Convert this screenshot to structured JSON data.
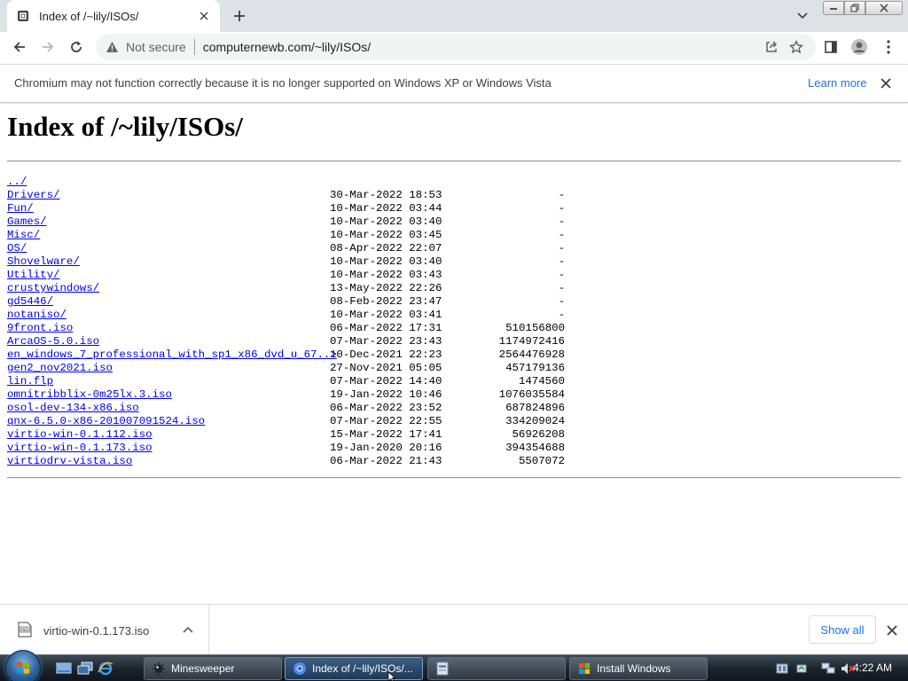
{
  "browser": {
    "tab_title": "Index of /~lily/ISOs/",
    "omnibox": {
      "security_label": "Not secure",
      "url": "computernewb.com/~lily/ISOs/"
    }
  },
  "infobar": {
    "message": "Chromium may not function correctly because it is no longer supported on Windows XP or Windows Vista",
    "link": "Learn more"
  },
  "page": {
    "title": "Index of /~lily/ISOs/",
    "entries": [
      {
        "name": "../",
        "date": "",
        "size": ""
      },
      {
        "name": "Drivers/",
        "date": "30-Mar-2022 18:53",
        "size": "-"
      },
      {
        "name": "Fun/",
        "date": "10-Mar-2022 03:44",
        "size": "-"
      },
      {
        "name": "Games/",
        "date": "10-Mar-2022 03:40",
        "size": "-"
      },
      {
        "name": "Misc/",
        "date": "10-Mar-2022 03:45",
        "size": "-"
      },
      {
        "name": "OS/",
        "date": "08-Apr-2022 22:07",
        "size": "-"
      },
      {
        "name": "Shovelware/",
        "date": "10-Mar-2022 03:40",
        "size": "-"
      },
      {
        "name": "Utility/",
        "date": "10-Mar-2022 03:43",
        "size": "-"
      },
      {
        "name": "crustywindows/",
        "date": "13-May-2022 22:26",
        "size": "-"
      },
      {
        "name": "gd5446/",
        "date": "08-Feb-2022 23:47",
        "size": "-"
      },
      {
        "name": "notaniso/",
        "date": "10-Mar-2022 03:41",
        "size": "-"
      },
      {
        "name": "9front.iso",
        "date": "06-Mar-2022 17:31",
        "size": "510156800"
      },
      {
        "name": "ArcaOS-5.0.iso",
        "date": "07-Mar-2022 23:43",
        "size": "1174972416"
      },
      {
        "name": "en_windows_7_professional_with_sp1_x86_dvd_u_67..>",
        "date": "10-Dec-2021 22:23",
        "size": "2564476928"
      },
      {
        "name": "gen2_nov2021.iso",
        "date": "27-Nov-2021 05:05",
        "size": "457179136"
      },
      {
        "name": "lin.flp",
        "date": "07-Mar-2022 14:40",
        "size": "1474560"
      },
      {
        "name": "omnitribblix-0m25lx.3.iso",
        "date": "19-Jan-2022 10:46",
        "size": "1076035584"
      },
      {
        "name": "osol-dev-134-x86.iso",
        "date": "06-Mar-2022 23:52",
        "size": "687824896"
      },
      {
        "name": "qnx-6.5.0-x86-201007091524.iso",
        "date": "07-Mar-2022 22:55",
        "size": "334209024"
      },
      {
        "name": "virtio-win-0.1.112.iso",
        "date": "15-Mar-2022 17:41",
        "size": "56926208"
      },
      {
        "name": "virtio-win-0.1.173.iso",
        "date": "19-Jan-2020 20:16",
        "size": "394354688"
      },
      {
        "name": "virtiodrv-vista.iso",
        "date": "06-Mar-2022 21:43",
        "size": "5507072"
      }
    ]
  },
  "downloads": {
    "item_name": "virtio-win-0.1.173.iso",
    "show_all": "Show all"
  },
  "taskbar": {
    "tasks": [
      {
        "label": "Minesweeper",
        "icon": "minesweeper-icon"
      },
      {
        "label": "Index of /~lily/ISOs/...",
        "icon": "chromium-icon"
      },
      {
        "label": "",
        "icon": "window-icon"
      },
      {
        "label": "Install Windows",
        "icon": "windows-setup-icon"
      }
    ],
    "clock": "4:22 AM"
  },
  "colors": {
    "link": "#0000ee",
    "accent": "#1a73e8",
    "tabstrip": "#dee1e6"
  }
}
